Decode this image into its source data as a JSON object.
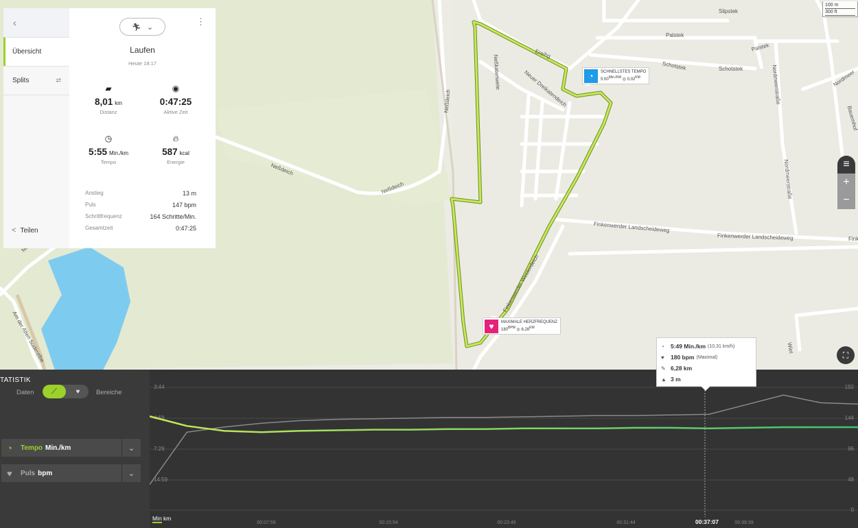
{
  "map": {
    "streets": [
      "Slipstek",
      "Palstek",
      "Palstek",
      "Schotstek",
      "Schotstek",
      "Nordmeerstraße",
      "Nordmeerstraße",
      "Nordmeer",
      "Bauernhof",
      "Neßdeich",
      "Neßdeich",
      "Neßdeich",
      "Finkenwerder Landscheideweg",
      "Finkenwerder Landscheideweg",
      "Fink",
      "Finkenwerder Westerdeich",
      "Neßkatenwete",
      "Neuer Dreikatendeich",
      "Am der Alten Süderelbe",
      "Neß",
      "Wiet",
      "Ereihg"
    ],
    "scale": [
      "100 m",
      "300 ft"
    ],
    "poi_fastest": {
      "title": "SCHNELLSTES TEMPO",
      "line2": "5:00",
      "unit": "Min./KM",
      "km": "0,02",
      "km_unit": "KM"
    },
    "poi_heart": {
      "title": "MAXIMALE HERZFREQUENZ",
      "line2": "180",
      "unit": "BPM",
      "km": "6,28",
      "km_unit": "KM"
    },
    "controls": {
      "layers_icon": "layers-icon",
      "zoom_in": "+",
      "zoom_out": "−",
      "fullscreen_icon": "fullscreen-icon"
    }
  },
  "nav": {
    "back_icon": "‹",
    "items": [
      {
        "label": "Übersicht",
        "active": true
      },
      {
        "label": "Splits",
        "active": false
      }
    ],
    "share_label": "Teilen"
  },
  "card": {
    "sport_icon": "running-icon",
    "title": "Laufen",
    "date": "Heute 18:17",
    "stats": [
      {
        "icon": "ruler-icon",
        "value": "8,01",
        "unit": "km",
        "label": "Distanz"
      },
      {
        "icon": "stopwatch-icon",
        "value": "0:47:25",
        "unit": "",
        "label": "Aktive Zeit"
      },
      {
        "icon": "speedometer-icon",
        "value": "5:55",
        "unit": "Min./km",
        "label": "Tempo"
      },
      {
        "icon": "flame-icon",
        "value": "587",
        "unit": "kcal",
        "label": "Energie"
      }
    ],
    "details": [
      {
        "key": "Anstieg",
        "value": "13",
        "unit": "m"
      },
      {
        "key": "Puls",
        "value": "147",
        "unit": "bpm"
      },
      {
        "key": "Schrittfrequenz",
        "value": "164",
        "unit": "Schritte/Min."
      },
      {
        "key": "Gesamtzeit",
        "value": "0:47:25",
        "unit": ""
      }
    ]
  },
  "statistik": {
    "heading": "TATISTIK",
    "tab_daten": "Daten",
    "tab_bereiche": "Bereiche",
    "metric1": {
      "name": "Tempo",
      "unit": "Min./km"
    },
    "metric2": {
      "name": "Puls",
      "unit": "bpm"
    },
    "tooltip": {
      "pace": "5:49 Min./km",
      "pace_sub": "(10,31 km/h)",
      "hr": "180 bpm",
      "hr_sub": "(Maximal)",
      "dist": "6,28 km",
      "elev": "3 m"
    },
    "xunit_left": "Min",
    "xunit_right": "km",
    "highlight_time": "00:37:07"
  },
  "chart_data": {
    "type": "line",
    "x_label": "",
    "x_ticks": [
      "00:07:59",
      "00:15:54",
      "00:23:49",
      "00:31:44",
      "00:37:07",
      "00:39:39"
    ],
    "y_left_ticks": [
      "3:44",
      "4:59",
      "7:29",
      "14:59",
      ""
    ],
    "y_right_ticks": [
      "192",
      "144",
      "96",
      "48",
      "0"
    ],
    "series": [
      {
        "name": "Tempo",
        "color": "#9bd12a",
        "values": [
          4.9,
          5.6,
          6.0,
          6.1,
          6.0,
          5.95,
          5.9,
          5.9,
          5.85,
          5.85,
          5.8,
          5.8,
          5.8,
          5.75,
          5.75,
          5.8,
          5.75,
          5.7,
          5.7,
          5.7
        ]
      },
      {
        "name": "Puls",
        "color": "#8a8a8a",
        "values": [
          40,
          122,
          130,
          136,
          140,
          142,
          143,
          144,
          145,
          145,
          146,
          147,
          148,
          148,
          149,
          150,
          165,
          180,
          168,
          166
        ]
      }
    ]
  }
}
